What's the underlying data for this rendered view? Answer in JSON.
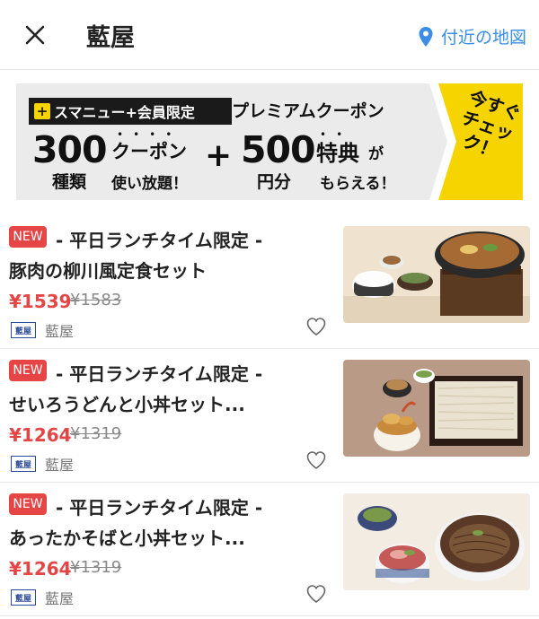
{
  "header": {
    "title": "藍屋",
    "map_link": "付近の地図",
    "accent_color": "#3a8ee6"
  },
  "banner": {
    "tag": "スマニュー+会員限定",
    "premium": "プレミアムクーポン",
    "count": "300",
    "count_unit": "種類",
    "coupon": "クーポン",
    "unlimited": "使い放題！",
    "plus": "+",
    "amount": "500",
    "amount_unit": "円分",
    "benefit": "特典",
    "benefit_suffix": "が",
    "receive": "もらえる！",
    "cta_line1": "今すぐ",
    "cta_line2": "チェック！",
    "cta_color": "#f5d400"
  },
  "items": [
    {
      "badge": "NEW",
      "name_line1": "- 平日ランチタイム限定 -",
      "name_line2": "豚肉の柳川風定食セット",
      "price": "¥1539",
      "original_price": "¥1583",
      "shop_logo": "藍屋",
      "shop": "藍屋"
    },
    {
      "badge": "NEW",
      "name_line1": "- 平日ランチタイム限定 -",
      "name_line2": "せいろうどんと小丼セット...",
      "price": "¥1264",
      "original_price": "¥1319",
      "shop_logo": "藍屋",
      "shop": "藍屋"
    },
    {
      "badge": "NEW",
      "name_line1": "- 平日ランチタイム限定 -",
      "name_line2": "あったかそばと小丼セット...",
      "price": "¥1264",
      "original_price": "¥1319",
      "shop_logo": "藍屋",
      "shop": "藍屋"
    }
  ],
  "colors": {
    "badge": "#e54545",
    "price": "#e54545"
  }
}
